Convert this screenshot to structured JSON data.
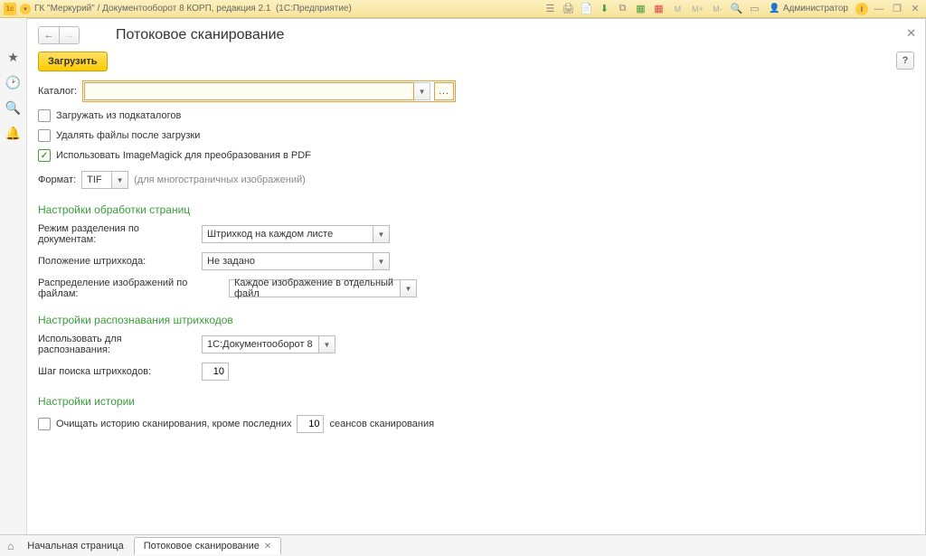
{
  "titlebar": {
    "company": "ГК \"Меркурий\"",
    "app": "Документооборот 8 КОРП, редакция 2.1",
    "platform": "(1С:Предприятие)",
    "admin": "Администратор"
  },
  "page": {
    "title": "Потоковое сканирование"
  },
  "actions": {
    "load": "Загрузить",
    "help": "?"
  },
  "catalog": {
    "label": "Каталог:",
    "value": ""
  },
  "checkboxes": {
    "subfolders": {
      "label": "Загружать из подкаталогов",
      "checked": false
    },
    "delete_after": {
      "label": "Удалять файлы после загрузки",
      "checked": false
    },
    "use_imagemagick": {
      "label": "Использовать ImageMagick для преобразования в PDF",
      "checked": true
    }
  },
  "format": {
    "label": "Формат:",
    "value": "TIF",
    "hint": "(для многостраничных изображений)"
  },
  "sections": {
    "pages": {
      "title": "Настройки обработки страниц",
      "split_mode": {
        "label": "Режим разделения по документам:",
        "value": "Штрихкод на каждом листе"
      },
      "barcode_pos": {
        "label": "Положение штрихкода:",
        "value": "Не задано"
      },
      "distribution": {
        "label": "Распределение изображений по файлам:",
        "value": "Каждое изображение в отдельный файл"
      }
    },
    "barcode": {
      "title": "Настройки распознавания штрихкодов",
      "engine": {
        "label": "Использовать для распознавания:",
        "value": "1С:Документооборот 8"
      },
      "step": {
        "label": "Шаг поиска штрихкодов:",
        "value": "10"
      }
    },
    "history": {
      "title": "Настройки истории",
      "clear": {
        "label": "Очищать историю сканирования, кроме последних",
        "value": "10",
        "suffix": "сеансов сканирования",
        "checked": false
      }
    }
  },
  "tabs": {
    "home": "Начальная страница",
    "current": "Потоковое сканирование"
  }
}
